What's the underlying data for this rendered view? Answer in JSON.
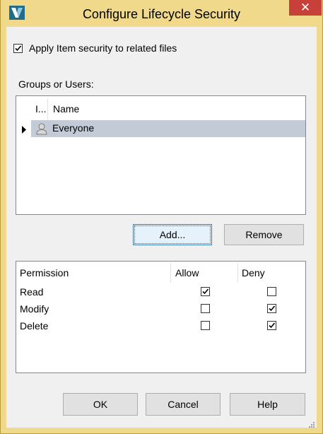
{
  "window": {
    "title": "Configure Lifecycle Security",
    "close_glyph": "✕",
    "app_icon": "vault-v-icon"
  },
  "apply_security": {
    "label": "Apply Item security to related files",
    "checked": true
  },
  "groups": {
    "label": "Groups or Users:",
    "columns": [
      "I...",
      "Name"
    ],
    "rows": [
      {
        "name": "Everyone",
        "icon": "user-icon",
        "selected": true,
        "current": true
      }
    ]
  },
  "buttons": {
    "add": "Add...",
    "remove": "Remove",
    "ok": "OK",
    "cancel": "Cancel",
    "help": "Help"
  },
  "permissions": {
    "columns": [
      "Permission",
      "Allow",
      "Deny"
    ],
    "rows": [
      {
        "name": "Read",
        "allow": true,
        "deny": false
      },
      {
        "name": "Modify",
        "allow": false,
        "deny": true
      },
      {
        "name": "Delete",
        "allow": false,
        "deny": true
      }
    ]
  },
  "colors": {
    "frame": "#f0d98a",
    "close": "#c7413a",
    "selection": "#c3ccd6",
    "default_button_border": "#3c7fb1"
  }
}
